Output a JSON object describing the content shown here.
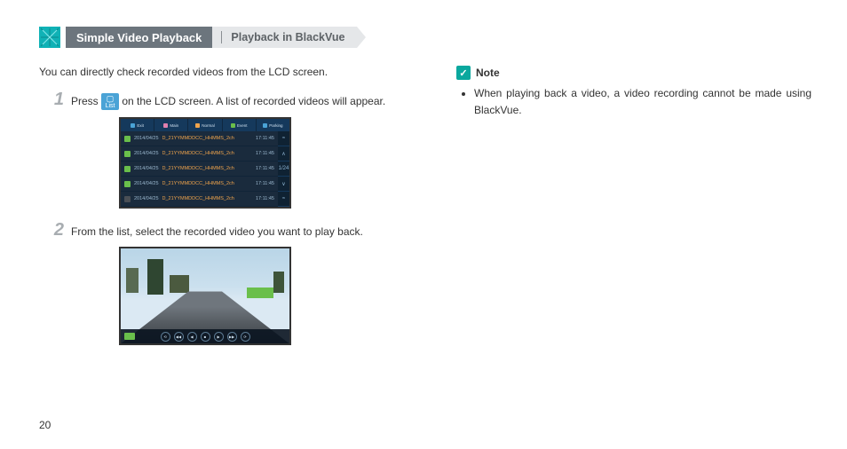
{
  "header": {
    "title_main": "Simple Video Playback",
    "title_sub": "Playback in BlackVue"
  },
  "intro": "You can directly check recorded videos from the LCD screen.",
  "steps": [
    {
      "num": "1",
      "pre": "Press ",
      "btn": "List",
      "post": " on the LCD screen. A list of recorded videos will appear."
    },
    {
      "num": "2",
      "text": "From the list, select the recorded video you want to play back."
    }
  ],
  "ss1": {
    "tabs": [
      {
        "label": "Exit",
        "color": "#4aa3d6"
      },
      {
        "label": "Main",
        "color": "#e07fae"
      },
      {
        "label": "Normal",
        "color": "#f0a44c"
      },
      {
        "label": "Event",
        "color": "#6abf4b"
      },
      {
        "label": "Parking",
        "color": "#4aa3d6"
      }
    ],
    "rows": [
      {
        "badge": "#6abf4b",
        "date": "2014/04/25",
        "fname": "D_21YYMMDDCC_HHMMS_2ch",
        "time": "17:11:45"
      },
      {
        "badge": "#6abf4b",
        "date": "2014/04/25",
        "fname": "D_21YYMMDDCC_HHMMS_2ch",
        "time": "17:11:45"
      },
      {
        "badge": "#6abf4b",
        "date": "2014/04/25",
        "fname": "D_21YYMMDDCC_HHMMS_2ch",
        "time": "17:11:45"
      },
      {
        "badge": "#6abf4b",
        "date": "2014/04/25",
        "fname": "D_21YYMMDDCC_HHMMS_2ch",
        "time": "17:11:45"
      },
      {
        "badge": "#4a4f55",
        "date": "2014/04/25",
        "fname": "D_21YYMMDDCC_HHMMS_2ch",
        "time": "17:11:45"
      }
    ],
    "ctrl": [
      "≈",
      "∧",
      "1/24",
      "∨",
      "≈"
    ]
  },
  "ss2": {
    "controls": [
      "⟲",
      "◀◀",
      "◀",
      "■",
      "▶",
      "▶▶",
      "⟳"
    ]
  },
  "note": {
    "label": "Note",
    "items": [
      "When playing back a video, a video recording cannot be made using BlackVue."
    ]
  },
  "page_number": "20"
}
